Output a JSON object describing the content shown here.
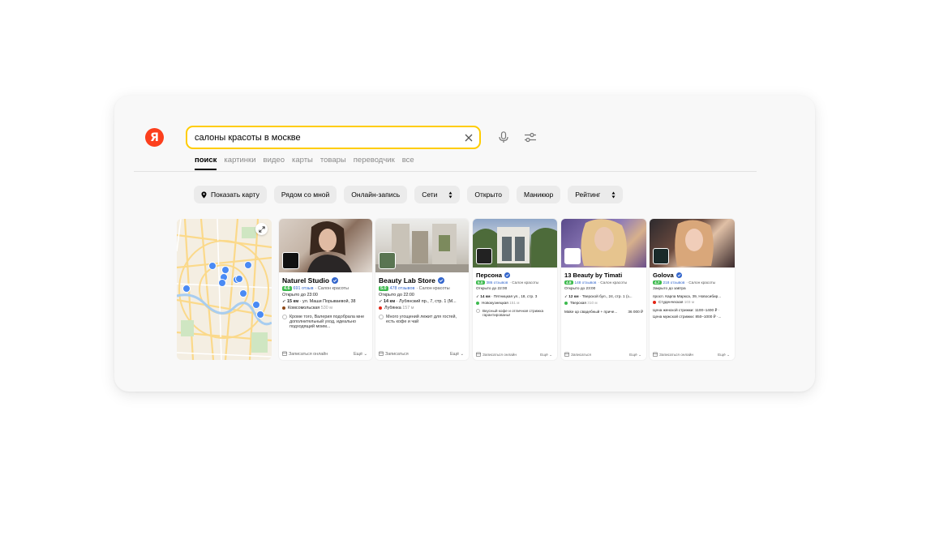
{
  "search": {
    "logo_letter": "Я",
    "query": "салоны красоты в москве"
  },
  "tabs": [
    "поиск",
    "картинки",
    "видео",
    "карты",
    "товары",
    "переводчик",
    "все"
  ],
  "active_tab": "поиск",
  "chips": {
    "show_map": "Показать карту",
    "nearby": "Рядом со мной",
    "online_booking": "Онлайн-запись",
    "networks": "Сети",
    "open": "Открыто",
    "manicure": "Маникюр",
    "rating": "Рейтинг"
  },
  "colors": {
    "brand": "#fc3f1d",
    "search_border": "#ffcc00",
    "rating_badge": "#3dba4e",
    "link": "#3366cc",
    "map_pin": "#4a8af4"
  },
  "cards": [
    {
      "name": "Naturel Studio",
      "rating": "4.6",
      "reviews": "691 отзыв",
      "category": "· Салон красоты",
      "hours": "Открыто до 23:00",
      "distance": "15 км",
      "address": "· ул. Маши Порываевой, 38",
      "metro": "Комсомольская",
      "metro_dist": "530 м",
      "metro_color": "#8b4513",
      "note": "Кроме того, Валерия подобрала мне дополнительный уход, идеально подходящий моим...",
      "book": "Записаться онлайн",
      "more": "Ещё"
    },
    {
      "name": "Beauty Lab Store",
      "rating": "5.0",
      "reviews": "478 отзывов",
      "category": "· Салон красоты",
      "hours": "Открыто до 22:00",
      "distance": "14 км",
      "address": "· Лубянский пр., 7, стр. 1 (М...",
      "metro": "Лубянка",
      "metro_dist": "157 м",
      "metro_color": "#e42313",
      "note": "Много угощений лежит для гостей, есть кофе и чай",
      "book": "Записаться",
      "more": "Ещё"
    },
    {
      "name": "Персона",
      "rating": "5.0",
      "reviews": "386 отзывов",
      "category": "· Салон красоты",
      "hours": "Открыто до 22:00",
      "distance": "14 км",
      "address": "· Пятницкая ул., 18, стр. 3",
      "metro": "Новокузнецкая",
      "metro_dist": "151 м",
      "metro_color": "#3dba4e",
      "note": "Вкусный кофе и отличная стрижка гарантированы!",
      "book": "Записаться онлайн",
      "more": "Ещё"
    },
    {
      "name": "13 Beauty by Timati",
      "rating": "4.8",
      "reviews": "148 отзывов",
      "category": "· Салон красоты",
      "hours": "Открыто до 23:00",
      "distance": "12 км",
      "address": "· Тверской бул., 24, стр. 1 (з...",
      "metro": "Тверская",
      "metro_dist": "310 м",
      "metro_color": "#3dba4e",
      "price_label": "Make up свадебный + приче...",
      "price_value": "36 000 ₽",
      "book": "Записаться",
      "more": "Ещё"
    },
    {
      "name": "Golova",
      "rating": "4.7",
      "reviews": "218 отзывов",
      "category": "· Салон красоты",
      "hours": "Закрыто до завтра",
      "address_full": "просп. Карла Маркса, 39, Новосибир...",
      "metro": "Студенческая",
      "metro_dist": "103 м",
      "metro_color": "#e42313",
      "price_line1": "Цена женской стрижки: 1100–1400 ₽ ·",
      "price_line2": "Цена мужской стрижки: 850–1000 ₽ ·...",
      "book": "Записаться онлайн",
      "more": "Ещё"
    }
  ]
}
